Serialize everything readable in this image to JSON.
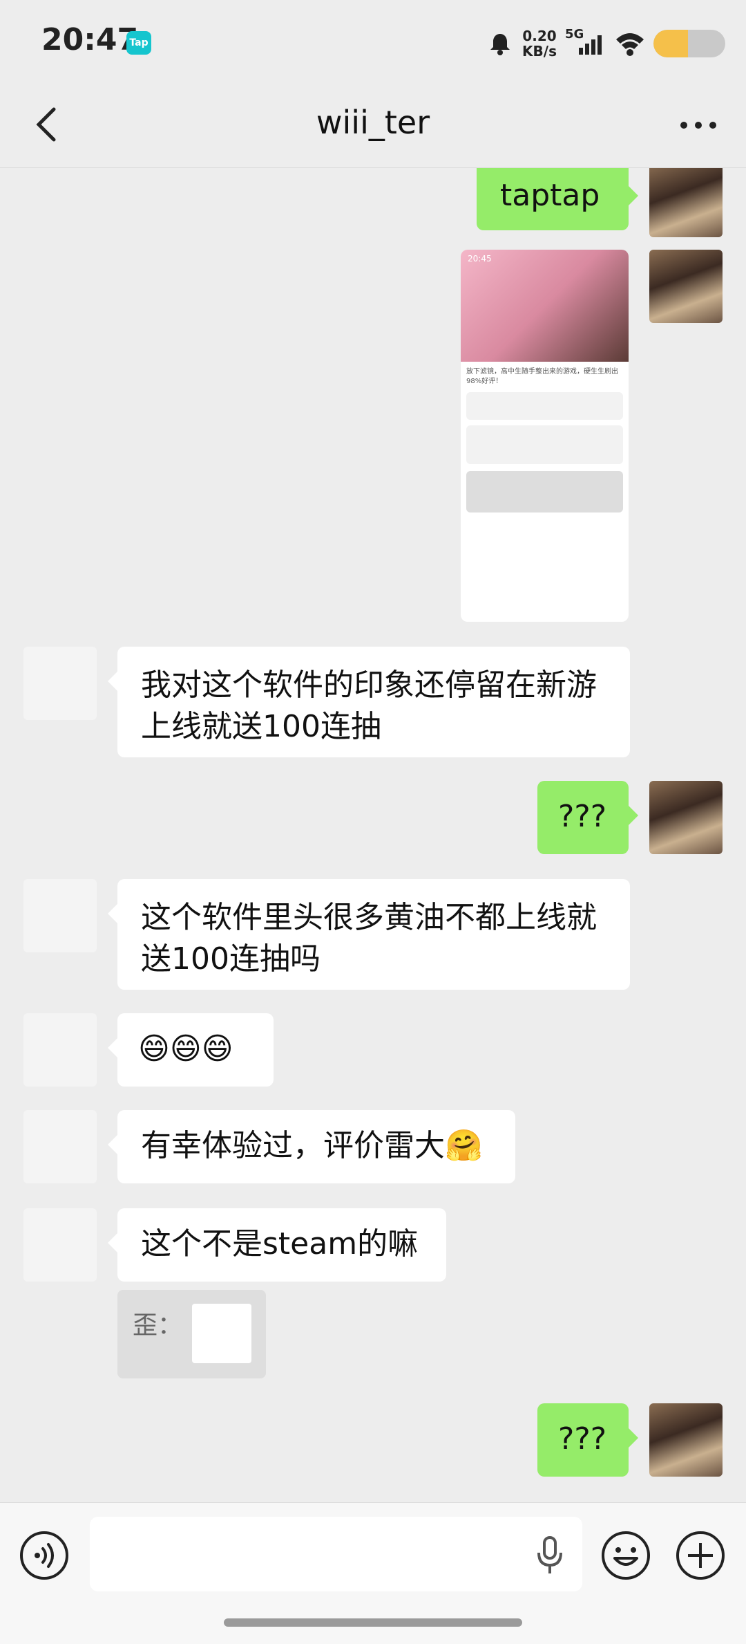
{
  "status": {
    "time": "20:47",
    "app_badge": "Tap",
    "speed_value": "0.20",
    "speed_unit": "KB/s",
    "network": "5G"
  },
  "header": {
    "title": "wiii_ter"
  },
  "messages": {
    "m1": "taptap",
    "m3": "我对这个软件的印象还停留在新游上线就送100连抽",
    "m4": "???",
    "m5": "这个软件里头很多黄油不都上线就送100连抽吗",
    "m6": "😄😄😄",
    "m7": "有幸体验过，评价雷大🤗",
    "m8": "这个不是steam的嘛",
    "m9_quote_label": "歪：",
    "m10": "???"
  },
  "shot": {
    "time": "20:45",
    "text": "放下滤镜，高中生随手整出来的游戏，硬生生刷出98%好评！"
  }
}
